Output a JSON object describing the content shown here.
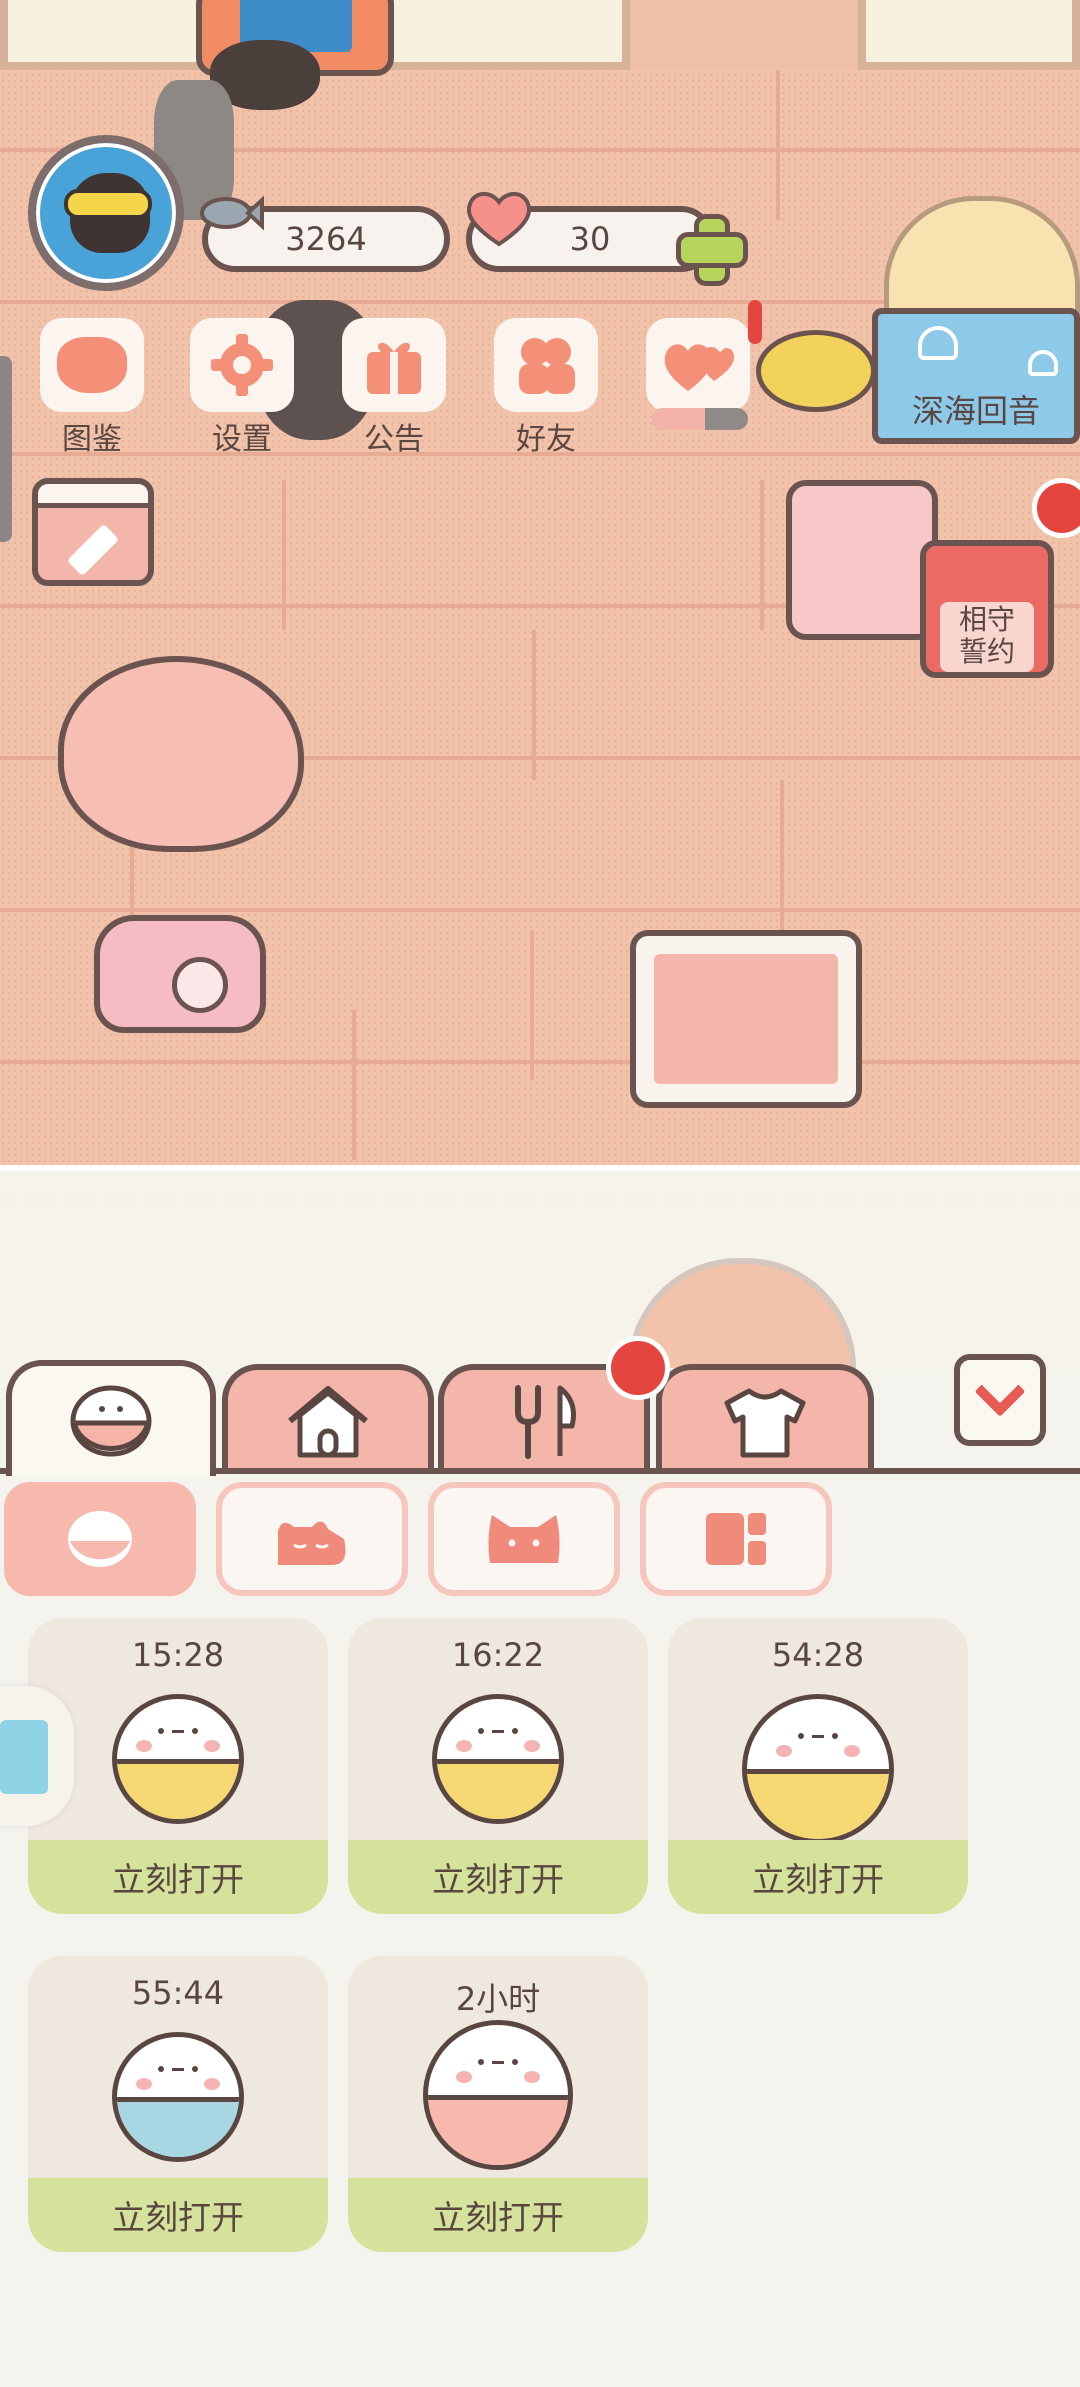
{
  "hud": {
    "fish_currency": "3264",
    "heart_currency": "30"
  },
  "menu": [
    {
      "id": "catalog",
      "label": "图鉴",
      "icon": "cat-head-icon"
    },
    {
      "id": "settings",
      "label": "设置",
      "icon": "gear-icon"
    },
    {
      "id": "notice",
      "label": "公告",
      "icon": "gift-icon"
    },
    {
      "id": "friends",
      "label": "好友",
      "icon": "friends-icon"
    },
    {
      "id": "hearts",
      "label": "",
      "icon": "hearts-icon"
    }
  ],
  "hearts_progress": 0.55,
  "event_banner": {
    "label": "深海回音"
  },
  "pledge_button": {
    "label_line1": "相守",
    "label_line2": "誓约"
  },
  "tabs": [
    {
      "id": "eggs",
      "icon": "egg-icon",
      "active": true
    },
    {
      "id": "home",
      "icon": "house-icon",
      "active": false
    },
    {
      "id": "food",
      "icon": "utensils-icon",
      "active": false,
      "badge": true
    },
    {
      "id": "clothes",
      "icon": "shirt-icon",
      "active": false
    }
  ],
  "subtabs": [
    {
      "id": "egg",
      "icon": "egg-outline-icon",
      "active": true
    },
    {
      "id": "cat-sleep",
      "icon": "sleeping-cat-icon",
      "active": false
    },
    {
      "id": "cat-head",
      "icon": "cat-face-icon",
      "active": false
    },
    {
      "id": "panel",
      "icon": "panel-icon",
      "active": false
    }
  ],
  "cards": [
    {
      "timer": "15:28",
      "action": "立刻打开",
      "fill_color": "#f6d873"
    },
    {
      "timer": "16:22",
      "action": "立刻打开",
      "fill_color": "#f6d873"
    },
    {
      "timer": "54:28",
      "action": "立刻打开",
      "fill_color": "#f6d873"
    },
    {
      "timer": "55:44",
      "action": "立刻打开",
      "fill_color": "#a9d6e3"
    },
    {
      "timer": "2小时",
      "action": "立刻打开",
      "fill_color": "#f8b8ae"
    }
  ],
  "colors": {
    "accent_red": "#e4453f",
    "tab_pink": "#f4b5ab",
    "card_footer_green": "#d5e29c",
    "outline_brown": "#6b5450"
  }
}
